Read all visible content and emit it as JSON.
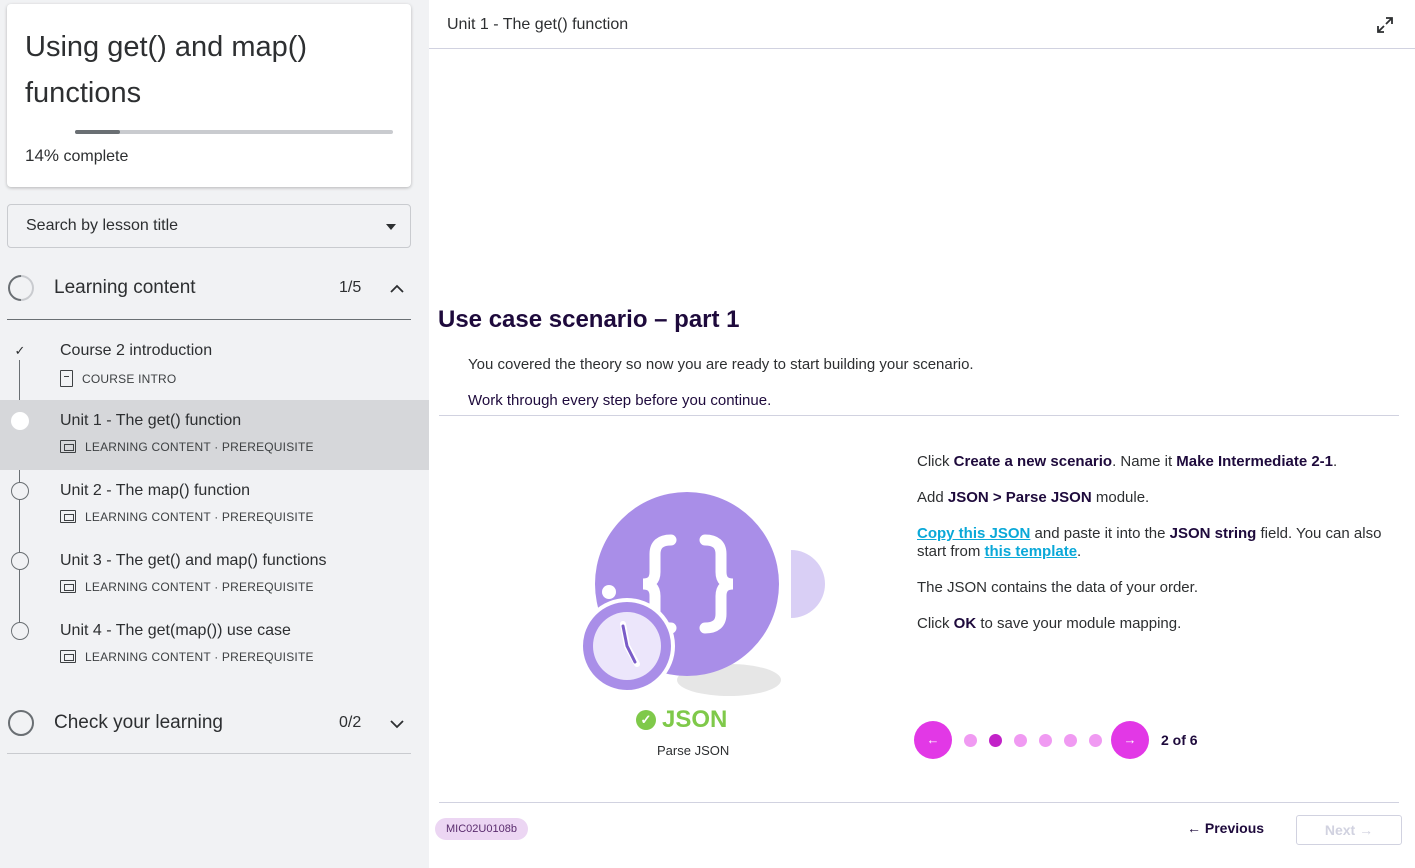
{
  "course": {
    "title": "Using get() and map() functions",
    "progress_percent": 14,
    "progress_pct_label": "14%",
    "progress_suffix": " complete"
  },
  "search": {
    "placeholder": "Search by lesson title"
  },
  "sections": [
    {
      "title": "Learning content",
      "count": "1/5",
      "expanded": true
    },
    {
      "title": "Check your learning",
      "count": "0/2",
      "expanded": false
    }
  ],
  "lessons": [
    {
      "name": "Course 2 introduction",
      "meta": "COURSE INTRO",
      "done": true,
      "active": false
    },
    {
      "name": "Unit 1 - The get() function",
      "meta": "LEARNING CONTENT · PREREQUISITE",
      "done": false,
      "active": true
    },
    {
      "name": "Unit 2 - The map() function",
      "meta": "LEARNING CONTENT · PREREQUISITE",
      "done": false,
      "active": false
    },
    {
      "name": "Unit 3 - The get() and map() functions",
      "meta": "LEARNING CONTENT · PREREQUISITE",
      "done": false,
      "active": false
    },
    {
      "name": "Unit 4 - The get(map()) use case",
      "meta": "LEARNING CONTENT · PREREQUISITE",
      "done": false,
      "active": false
    }
  ],
  "main": {
    "unit_title": "Unit 1 - The get() function",
    "scenario_title": "Use case scenario – part 1",
    "intro1": "You covered the theory so now you are ready to start building your scenario.",
    "intro2": "Work through every step before you continue.",
    "module_name": "JSON",
    "module_sub": "Parse JSON",
    "steps": {
      "s1_a": "Click ",
      "s1_b": "Create a new scenario",
      "s1_c": ". Name it ",
      "s1_d": "Make Intermediate 2-1",
      "s1_e": ".",
      "s2_a": "Add ",
      "s2_b": "JSON > Parse JSON",
      "s2_c": " module.",
      "s3_link1": "Copy this JSON",
      "s3_a": " and paste it into the ",
      "s3_b": "JSON string",
      "s3_c": " field. You can also start from ",
      "s3_link2": "this template",
      "s3_d": ".",
      "s4": "The JSON contains the data of your order.",
      "s5_a": "Click ",
      "s5_b": "OK",
      "s5_c": " to save your module mapping."
    },
    "pager": {
      "current": 2,
      "total": 6,
      "label": "2 of 6"
    },
    "code_badge": "MIC02U0108b",
    "prev_label": "Previous",
    "next_label": "Next"
  },
  "colors": {
    "accent_magenta": "#e238e6",
    "module_purple": "#a98ee8",
    "json_green": "#7fc94a",
    "link_blue": "#0aa8d8"
  },
  "icons": [
    "chevron-up-icon",
    "chevron-down-icon",
    "check-icon",
    "expand-icon",
    "arrow-left-icon",
    "arrow-right-icon",
    "clock-icon",
    "json-braces-icon"
  ]
}
